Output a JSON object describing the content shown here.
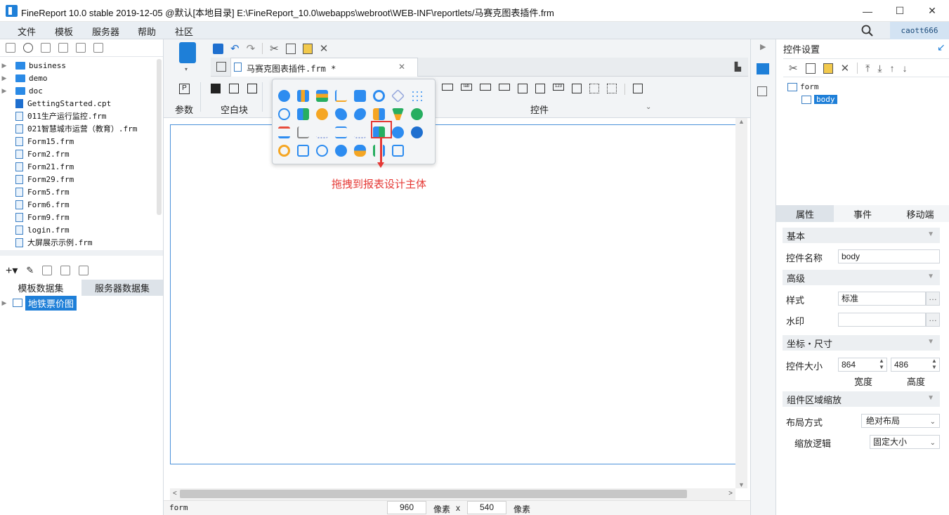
{
  "window": {
    "title": "FineReport 10.0 stable 2019-12-05 @默认[本地目录]    E:\\FineReport_10.0\\webapps\\webroot\\WEB-INF\\reportlets/马赛克图表插件.frm",
    "minimize": "—",
    "maximize": "☐",
    "close": "✕"
  },
  "menu": {
    "items": [
      "文件",
      "模板",
      "服务器",
      "帮助",
      "社区"
    ],
    "user": "caott666"
  },
  "file_tree": {
    "items": [
      {
        "type": "folder",
        "label": "business"
      },
      {
        "type": "folder",
        "label": "demo"
      },
      {
        "type": "folder",
        "label": "doc"
      },
      {
        "type": "cpt",
        "label": "GettingStarted.cpt"
      },
      {
        "type": "frm",
        "label": "011生产运行监控.frm"
      },
      {
        "type": "frm",
        "label": "021智慧城市运营（教育）.frm"
      },
      {
        "type": "frm",
        "label": "Form15.frm"
      },
      {
        "type": "frm",
        "label": "Form2.frm"
      },
      {
        "type": "frm",
        "label": "Form21.frm"
      },
      {
        "type": "frm",
        "label": "Form29.frm"
      },
      {
        "type": "frm",
        "label": "Form5.frm"
      },
      {
        "type": "frm",
        "label": "Form6.frm"
      },
      {
        "type": "frm",
        "label": "Form9.frm"
      },
      {
        "type": "frm",
        "label": "login.frm"
      },
      {
        "type": "frm",
        "label": "大屏展示示例.frm"
      }
    ]
  },
  "dataset": {
    "tabs": [
      "模板数据集",
      "服务器数据集"
    ],
    "items": [
      "地铁票价图"
    ]
  },
  "editor": {
    "tab_title": "马赛克图表插件.frm *",
    "ribbon": {
      "param_label": "参数",
      "blank_label": "空白块",
      "widget_label": "控件"
    },
    "drag_hint": "拖拽到报表设计主体"
  },
  "status": {
    "left": "form",
    "width": "960",
    "unit1": "像素",
    "x": "x",
    "height": "540",
    "unit2": "像素"
  },
  "right_panel": {
    "title": "控件设置",
    "tree": {
      "root": "form",
      "child": "body"
    },
    "tabs": [
      "属性",
      "事件",
      "移动端"
    ],
    "sections": {
      "basic": "基本",
      "advanced": "高级",
      "coords": "坐标・尺寸",
      "scale": "组件区域缩放"
    },
    "fields": {
      "name_label": "控件名称",
      "name_value": "body",
      "style_label": "样式",
      "style_value": "标准",
      "watermark_label": "水印",
      "watermark_value": "",
      "size_label": "控件大小",
      "width_value": "864",
      "height_value": "486",
      "width_caption": "宽度",
      "height_caption": "高度",
      "layout_label": "布局方式",
      "layout_value": "绝对布局",
      "scale_label": "缩放逻辑",
      "scale_value": "固定大小"
    }
  },
  "colors": {
    "accent": "#1e7fd8",
    "highlight": "#e53935",
    "selection": "#1e7fd8"
  }
}
